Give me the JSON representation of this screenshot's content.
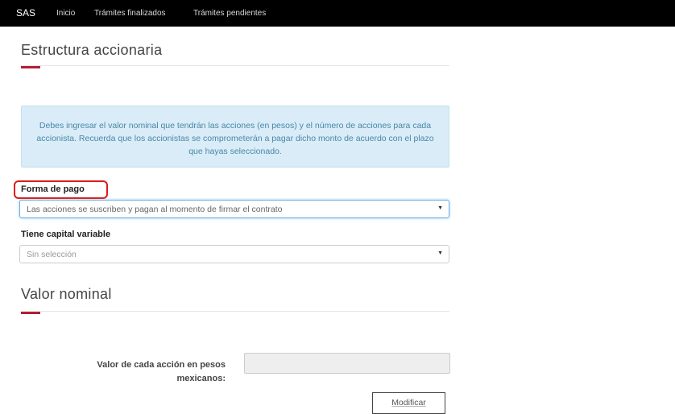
{
  "navbar": {
    "brand": "SAS",
    "links": [
      "Inicio",
      "Trámites finalizados",
      "Trámites pendientes"
    ]
  },
  "estructura": {
    "title": "Estructura accionaria",
    "info": "Debes ingresar el valor nominal que tendrán las acciones (en pesos) y el número de acciones para cada accionista. Recuerda que los accionistas se comprometerán a pagar dicho monto de acuerdo con el plazo que hayas seleccionado."
  },
  "forma_pago": {
    "label": "Forma de pago",
    "selected": "Las acciones se suscriben y pagan al momento de firmar el contrato"
  },
  "capital_variable": {
    "label": "Tiene capital variable",
    "selected": "Sin selección"
  },
  "valor_nominal": {
    "title": "Valor nominal",
    "input_label": "Valor de cada acción en pesos mexicanos:",
    "input_value": "",
    "button": "Modificar"
  },
  "icons": {
    "caret": "caret-down-icon"
  },
  "colors": {
    "accent": "#b21f34",
    "highlight": "#e01818",
    "info_bg": "#d9ecf7",
    "navbar": "#000000"
  }
}
